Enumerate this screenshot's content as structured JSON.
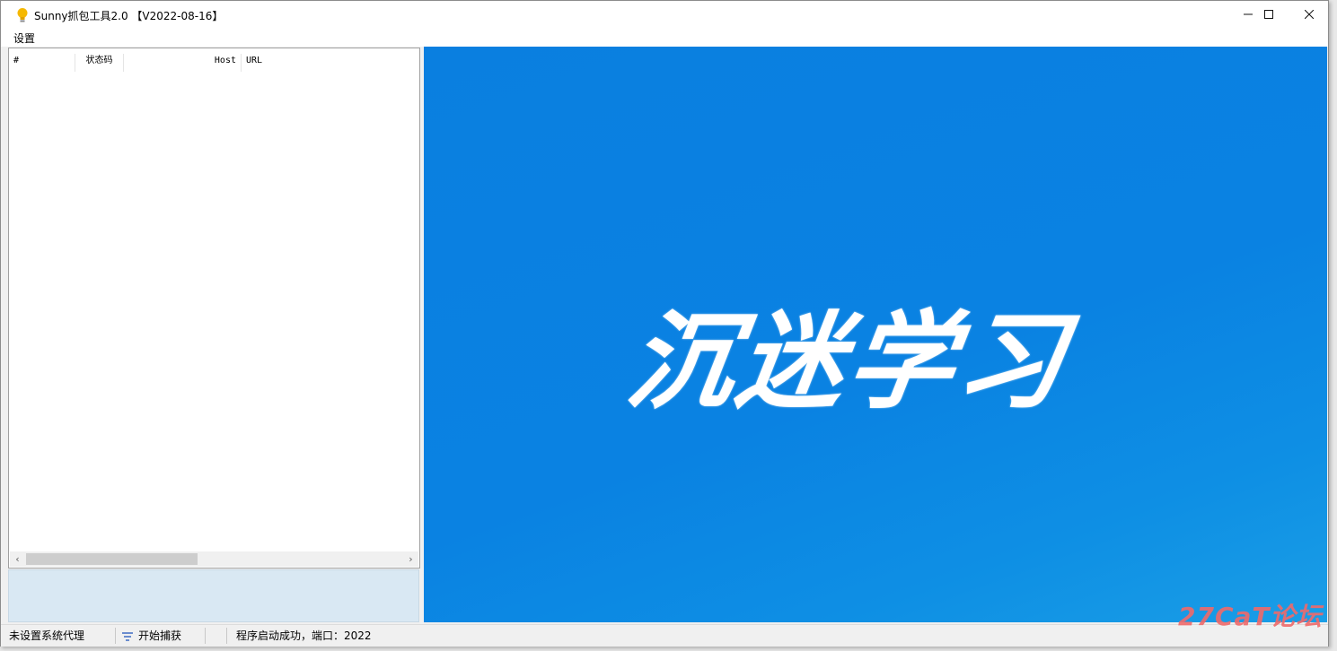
{
  "window": {
    "title": "Sunny抓包工具2.0 【V2022-08-16】",
    "controls": {
      "minimize": "minimize-icon",
      "maximize": "maximize-icon",
      "close": "close-icon"
    }
  },
  "menu": {
    "items": [
      {
        "label": "设置"
      }
    ]
  },
  "request_list": {
    "columns": [
      {
        "label": "#"
      },
      {
        "label": "状态码"
      },
      {
        "label": "Host"
      },
      {
        "label": "URL"
      }
    ],
    "rows": []
  },
  "image_panel": {
    "slogan": "沉迷学习"
  },
  "statusbar": {
    "proxy_status": "未设置系统代理",
    "capture_button": "开始捕获",
    "message": "程序启动成功，端口：2022"
  },
  "watermark": "27CaT论坛",
  "colors": {
    "panel_blue": "#0a82e2",
    "bottom_left_bg": "#d9e8f3",
    "watermark": "#f06a6a"
  }
}
